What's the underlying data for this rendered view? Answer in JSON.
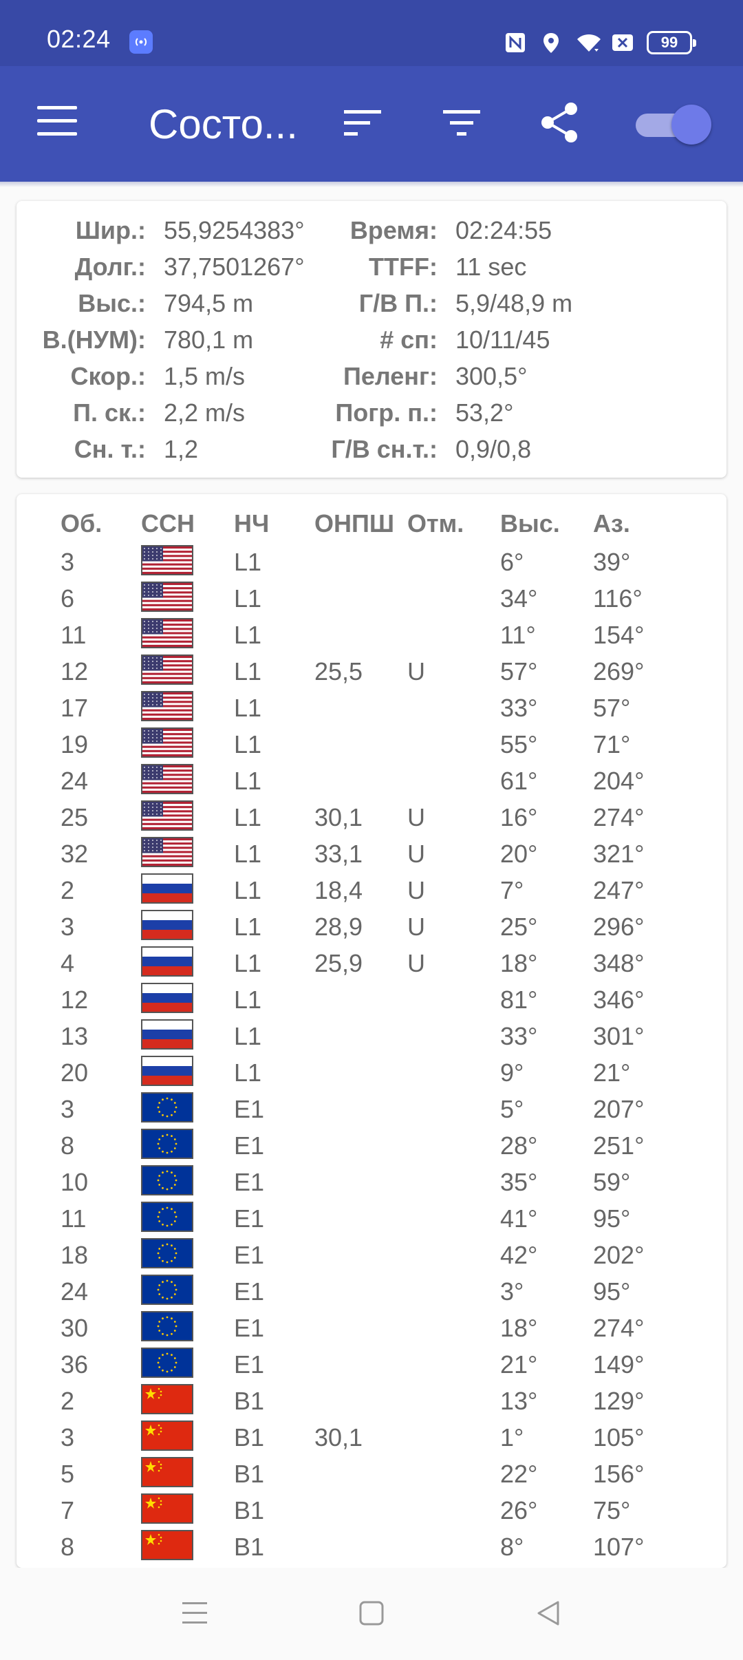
{
  "status_bar": {
    "time": "02:24",
    "battery": "99",
    "icons": [
      "cast-icon",
      "nfc-icon",
      "location-icon",
      "wifi-icon",
      "sim-icon",
      "battery-icon"
    ]
  },
  "app_bar": {
    "title": "Состо...",
    "icons": [
      "menu-icon",
      "sort-icon",
      "filter-icon",
      "share-icon",
      "toggle-switch"
    ],
    "toggle_on": true,
    "colors": {
      "primary": "#3f51b5",
      "status": "#3849a6",
      "accent": "#6e7ae8"
    }
  },
  "status": {
    "left": [
      {
        "label": "Шир.:",
        "value": "55,9254383°"
      },
      {
        "label": "Долг.:",
        "value": "37,7501267°"
      },
      {
        "label": "Выс.:",
        "value": "794,5 m"
      },
      {
        "label": "В.(НУМ):",
        "value": "780,1 m"
      },
      {
        "label": "Скор.:",
        "value": "1,5 m/s"
      },
      {
        "label": "П. ск.:",
        "value": "2,2 m/s"
      },
      {
        "label": "Сн. т.:",
        "value": "1,2"
      }
    ],
    "right": [
      {
        "label": "Время:",
        "value": "02:24:55"
      },
      {
        "label": "TTFF:",
        "value": "11 sec"
      },
      {
        "label": "Г/В П.:",
        "value": "5,9/48,9 m"
      },
      {
        "label": "# сп:",
        "value": "10/11/45"
      },
      {
        "label": "Пеленг:",
        "value": "300,5°"
      },
      {
        "label": "Погр. п.:",
        "value": "53,2°"
      },
      {
        "label": "Г/В сн.т.:",
        "value": "0,9/0,8"
      }
    ]
  },
  "table": {
    "headers": [
      "Об.",
      "ССН",
      "НЧ",
      "ОНПШ",
      "Отм.",
      "Выс.",
      "Аз."
    ],
    "rows": [
      {
        "id": "3",
        "flag": "us",
        "freq": "L1",
        "cn0": "",
        "flags": "",
        "elev": "6°",
        "az": "39°"
      },
      {
        "id": "6",
        "flag": "us",
        "freq": "L1",
        "cn0": "",
        "flags": "",
        "elev": "34°",
        "az": "116°"
      },
      {
        "id": "11",
        "flag": "us",
        "freq": "L1",
        "cn0": "",
        "flags": "",
        "elev": "11°",
        "az": "154°"
      },
      {
        "id": "12",
        "flag": "us",
        "freq": "L1",
        "cn0": "25,5",
        "flags": "U",
        "elev": "57°",
        "az": "269°"
      },
      {
        "id": "17",
        "flag": "us",
        "freq": "L1",
        "cn0": "",
        "flags": "",
        "elev": "33°",
        "az": "57°"
      },
      {
        "id": "19",
        "flag": "us",
        "freq": "L1",
        "cn0": "",
        "flags": "",
        "elev": "55°",
        "az": "71°"
      },
      {
        "id": "24",
        "flag": "us",
        "freq": "L1",
        "cn0": "",
        "flags": "",
        "elev": "61°",
        "az": "204°"
      },
      {
        "id": "25",
        "flag": "us",
        "freq": "L1",
        "cn0": "30,1",
        "flags": "U",
        "elev": "16°",
        "az": "274°"
      },
      {
        "id": "32",
        "flag": "us",
        "freq": "L1",
        "cn0": "33,1",
        "flags": "U",
        "elev": "20°",
        "az": "321°"
      },
      {
        "id": "2",
        "flag": "ru",
        "freq": "L1",
        "cn0": "18,4",
        "flags": "U",
        "elev": "7°",
        "az": "247°"
      },
      {
        "id": "3",
        "flag": "ru",
        "freq": "L1",
        "cn0": "28,9",
        "flags": "U",
        "elev": "25°",
        "az": "296°"
      },
      {
        "id": "4",
        "flag": "ru",
        "freq": "L1",
        "cn0": "25,9",
        "flags": "U",
        "elev": "18°",
        "az": "348°"
      },
      {
        "id": "12",
        "flag": "ru",
        "freq": "L1",
        "cn0": "",
        "flags": "",
        "elev": "81°",
        "az": "346°"
      },
      {
        "id": "13",
        "flag": "ru",
        "freq": "L1",
        "cn0": "",
        "flags": "",
        "elev": "33°",
        "az": "301°"
      },
      {
        "id": "20",
        "flag": "ru",
        "freq": "L1",
        "cn0": "",
        "flags": "",
        "elev": "9°",
        "az": "21°"
      },
      {
        "id": "3",
        "flag": "eu",
        "freq": "E1",
        "cn0": "",
        "flags": "",
        "elev": "5°",
        "az": "207°"
      },
      {
        "id": "8",
        "flag": "eu",
        "freq": "E1",
        "cn0": "",
        "flags": "",
        "elev": "28°",
        "az": "251°"
      },
      {
        "id": "10",
        "flag": "eu",
        "freq": "E1",
        "cn0": "",
        "flags": "",
        "elev": "35°",
        "az": "59°"
      },
      {
        "id": "11",
        "flag": "eu",
        "freq": "E1",
        "cn0": "",
        "flags": "",
        "elev": "41°",
        "az": "95°"
      },
      {
        "id": "18",
        "flag": "eu",
        "freq": "E1",
        "cn0": "",
        "flags": "",
        "elev": "42°",
        "az": "202°"
      },
      {
        "id": "24",
        "flag": "eu",
        "freq": "E1",
        "cn0": "",
        "flags": "",
        "elev": "3°",
        "az": "95°"
      },
      {
        "id": "30",
        "flag": "eu",
        "freq": "E1",
        "cn0": "",
        "flags": "",
        "elev": "18°",
        "az": "274°"
      },
      {
        "id": "36",
        "flag": "eu",
        "freq": "E1",
        "cn0": "",
        "flags": "",
        "elev": "21°",
        "az": "149°"
      },
      {
        "id": "2",
        "flag": "cn",
        "freq": "B1",
        "cn0": "",
        "flags": "",
        "elev": "13°",
        "az": "129°"
      },
      {
        "id": "3",
        "flag": "cn",
        "freq": "B1",
        "cn0": "30,1",
        "flags": "",
        "elev": "1°",
        "az": "105°"
      },
      {
        "id": "5",
        "flag": "cn",
        "freq": "B1",
        "cn0": "",
        "flags": "",
        "elev": "22°",
        "az": "156°"
      },
      {
        "id": "7",
        "flag": "cn",
        "freq": "B1",
        "cn0": "",
        "flags": "",
        "elev": "26°",
        "az": "75°"
      },
      {
        "id": "8",
        "flag": "cn",
        "freq": "B1",
        "cn0": "",
        "flags": "",
        "elev": "8°",
        "az": "107°"
      }
    ]
  },
  "nav_bar": {
    "icons": [
      "recents-icon",
      "home-icon",
      "back-icon"
    ]
  }
}
